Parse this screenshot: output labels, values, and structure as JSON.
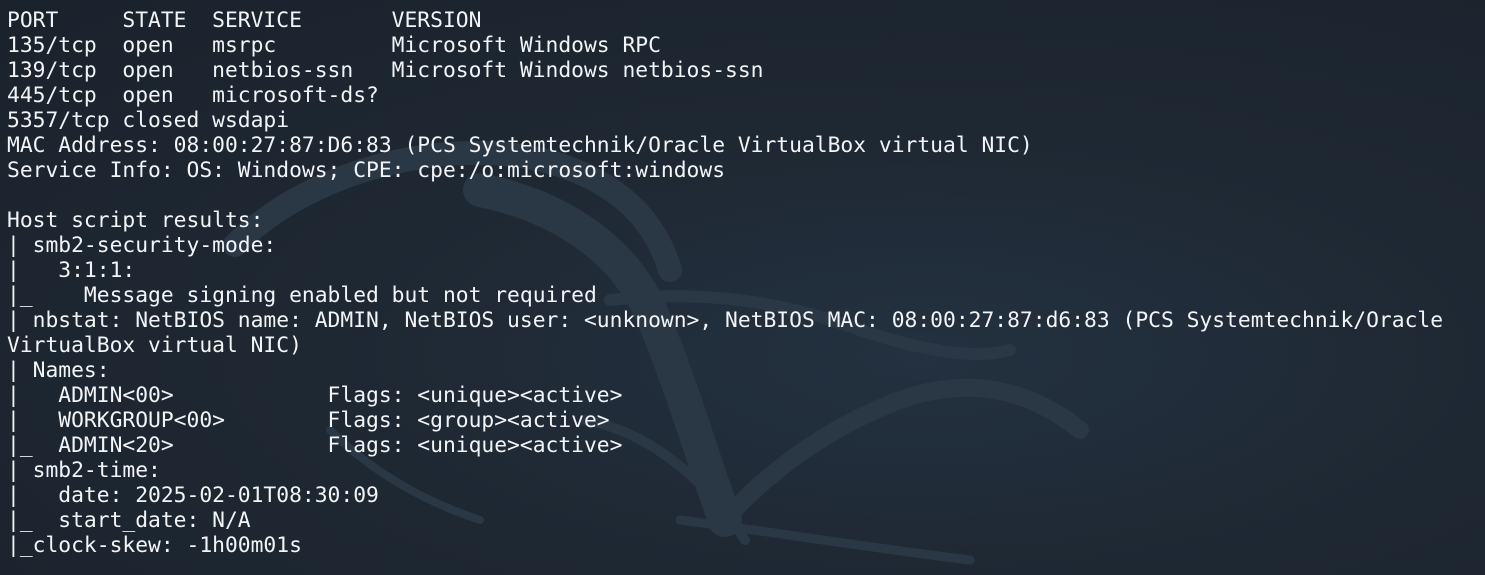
{
  "terminal": {
    "lines": [
      "PORT     STATE  SERVICE       VERSION",
      "135/tcp  open   msrpc         Microsoft Windows RPC",
      "139/tcp  open   netbios-ssn   Microsoft Windows netbios-ssn",
      "445/tcp  open   microsoft-ds?",
      "5357/tcp closed wsdapi",
      "MAC Address: 08:00:27:87:D6:83 (PCS Systemtechnik/Oracle VirtualBox virtual NIC)",
      "Service Info: OS: Windows; CPE: cpe:/o:microsoft:windows",
      "",
      "Host script results:",
      "| smb2-security-mode:",
      "|   3:1:1:",
      "|_    Message signing enabled but not required",
      "| nbstat: NetBIOS name: ADMIN, NetBIOS user: <unknown>, NetBIOS MAC: 08:00:27:87:d6:83 (PCS Systemtechnik/Oracle",
      "VirtualBox virtual NIC)",
      "| Names:",
      "|   ADMIN<00>            Flags: <unique><active>",
      "|   WORKGROUP<00>        Flags: <group><active>",
      "|_  ADMIN<20>            Flags: <unique><active>",
      "| smb2-time:",
      "|   date: 2025-02-01T08:30:09",
      "|_  start_date: N/A",
      "|_clock-skew: -1h00m01s"
    ]
  },
  "colors": {
    "background": "#1c2530",
    "text": "#f2f4f7",
    "watermark": "#2a3846"
  },
  "icons": {
    "background_watermark": "kali-dragon-icon"
  }
}
